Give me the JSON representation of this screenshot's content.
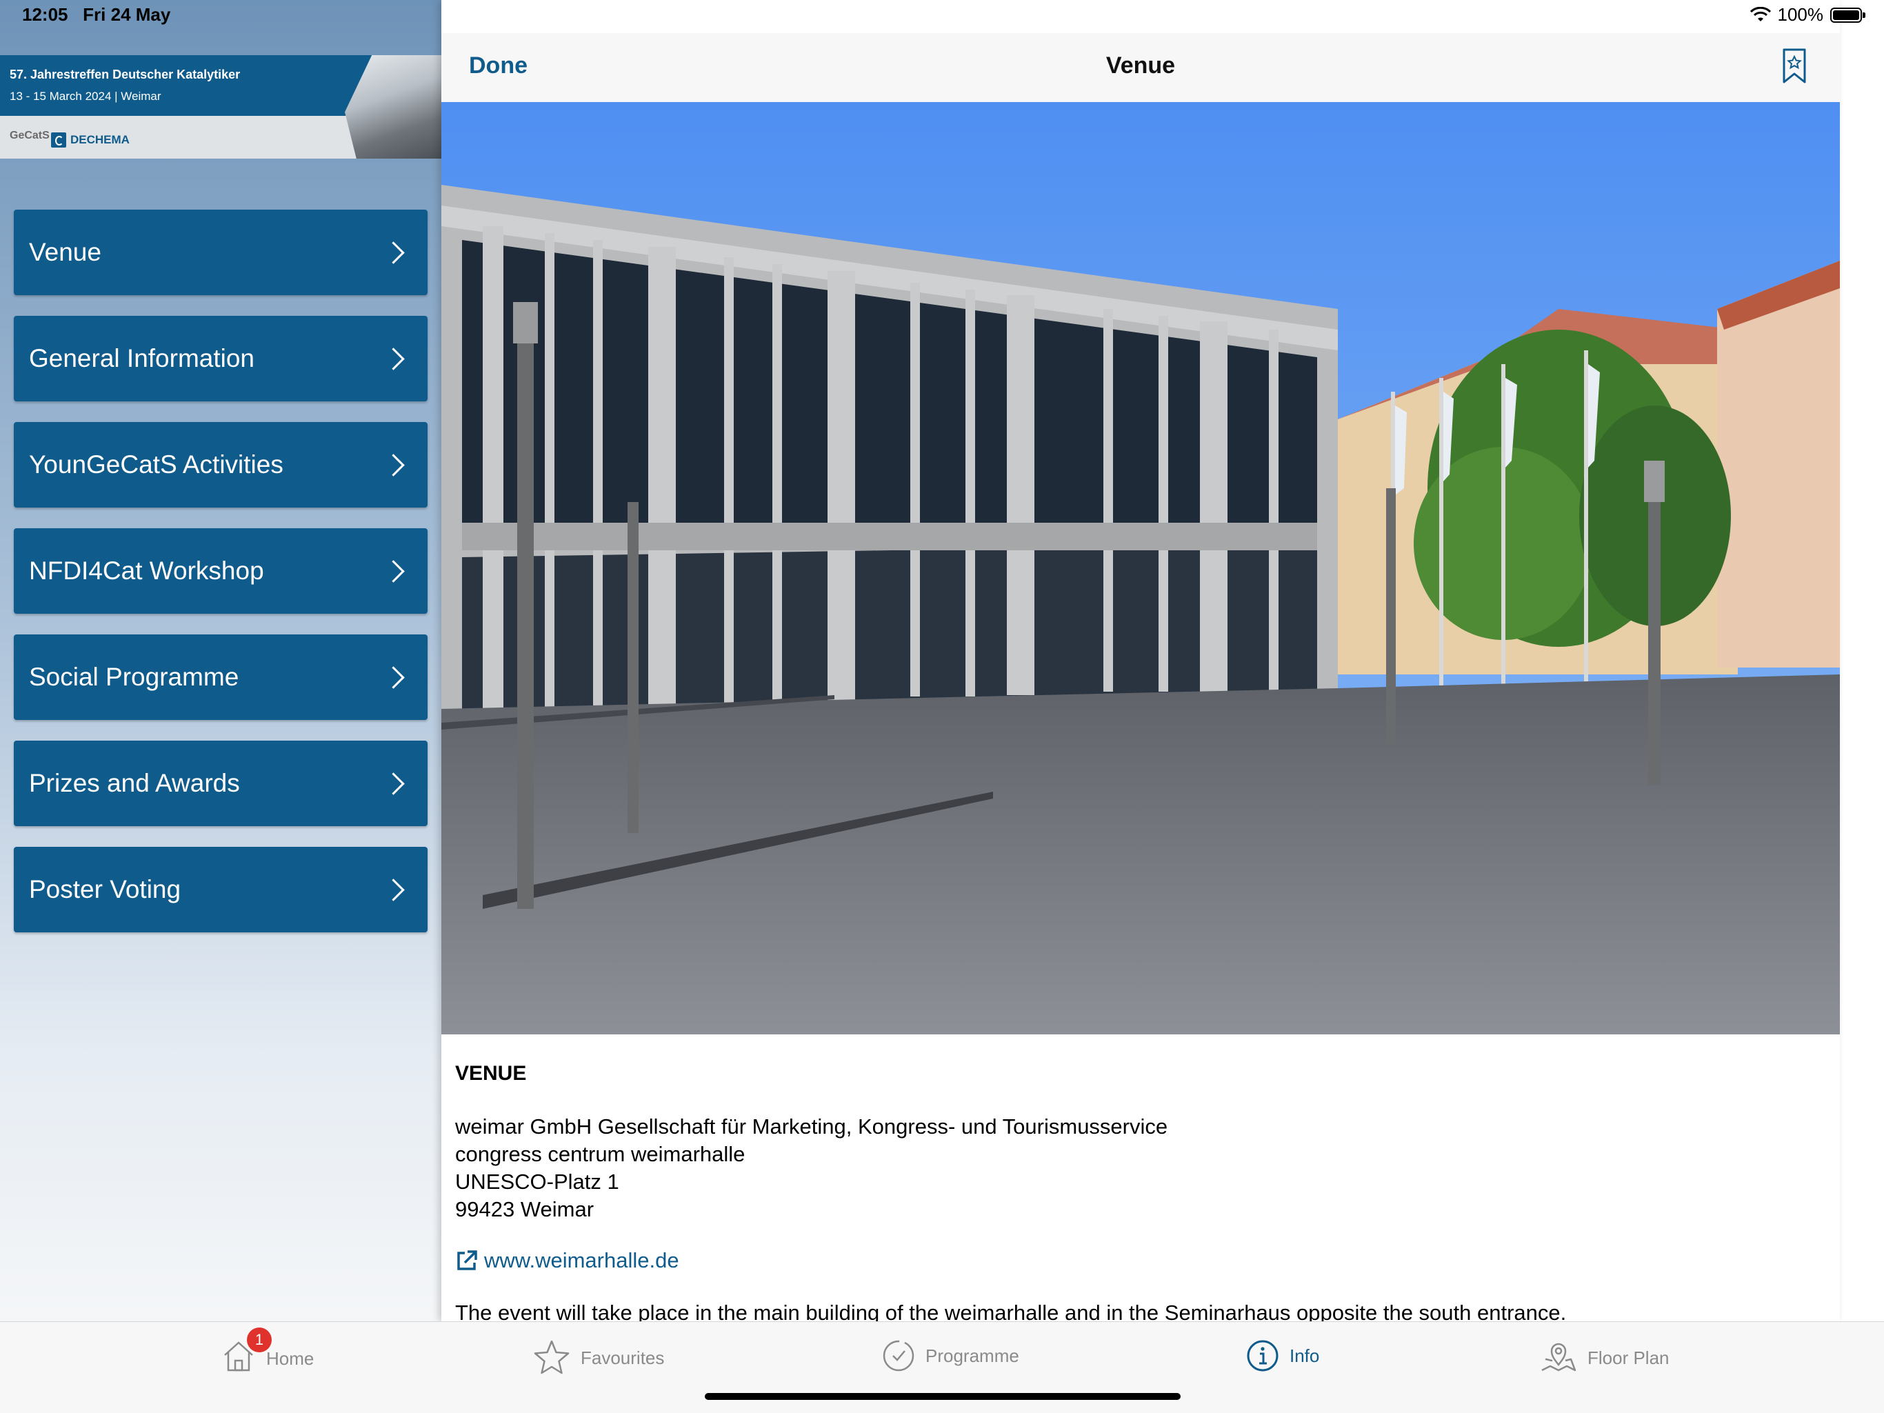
{
  "status_bar": {
    "time": "12:05",
    "date": "Fri 24 May",
    "battery": "100%"
  },
  "sidebar": {
    "banner": {
      "title": "57. Jahrestreffen Deutscher Katalytiker",
      "subtitle": "13 - 15 March 2024 | Weimar",
      "logo_gecats": "GeCatS",
      "logo_dechema": "DECHEMA"
    },
    "items": [
      {
        "label": "Venue"
      },
      {
        "label": "General Information"
      },
      {
        "label": "YounGeCatS Activities"
      },
      {
        "label": "NFDI4Cat Workshop"
      },
      {
        "label": "Social Programme"
      },
      {
        "label": "Prizes and Awards"
      },
      {
        "label": "Poster Voting"
      }
    ]
  },
  "detail": {
    "back_label": "Done",
    "title": "Venue",
    "heading": "VENUE",
    "address": [
      "weimar GmbH Gesellschaft für Marketing, Kongress- und Tourismusservice",
      "congress centrum weimarhalle",
      "UNESCO-Platz 1",
      "99423 Weimar"
    ],
    "link": "www.weimarhalle.de",
    "body_text": "The event will take place in the main building of the weimarhalle and in the Seminarhaus opposite the south entrance."
  },
  "tabs": [
    {
      "label": "Home",
      "icon": "home-icon",
      "badge": "1"
    },
    {
      "label": "Favourites",
      "icon": "star-icon"
    },
    {
      "label": "Programme",
      "icon": "clock-icon"
    },
    {
      "label": "Info",
      "icon": "info-icon",
      "active": true
    },
    {
      "label": "Floor Plan",
      "icon": "map-icon"
    }
  ],
  "colors": {
    "accent": "#0f5c8c",
    "badge": "#e0322c"
  }
}
